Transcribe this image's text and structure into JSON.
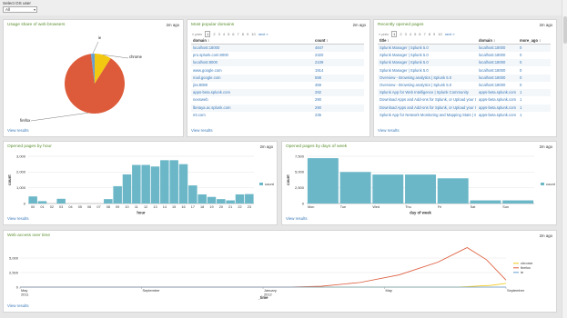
{
  "header": {
    "select_label": "Select OS user",
    "select_value": "All"
  },
  "p1": {
    "title": "Usage share of web browsers",
    "time": "2m ago",
    "link": "View results",
    "slices": [
      {
        "label": "chrome",
        "value": 9,
        "color": "#f2c811"
      },
      {
        "label": "firefox",
        "value": 89,
        "color": "#dd5b3a"
      },
      {
        "label": "ie",
        "value": 2,
        "color": "#6aa0cf"
      }
    ]
  },
  "p2": {
    "title": "Most popular domains",
    "time": "2m ago",
    "link": "View results",
    "pager": {
      "prev": "« prev",
      "pages": [
        "1",
        "2",
        "3",
        "4",
        "5",
        "6",
        "7",
        "8",
        "9",
        "10"
      ],
      "next": "next »"
    },
    "columns": [
      "domain ↕",
      "count ↕"
    ],
    "rows": [
      [
        "localhost:18000",
        "4847"
      ],
      [
        "pro.splunk.com:8000",
        "2320"
      ],
      [
        "localhost:8000",
        "2109"
      ],
      [
        "www.google.com",
        "1914"
      ],
      [
        "mail.google.com",
        "598"
      ],
      [
        "jira:8080",
        "459"
      ],
      [
        "apps-beta.splunk.com",
        "292"
      ],
      [
        "nexsweb",
        "290"
      ],
      [
        "lbetaya.ac.splunk.com",
        "290"
      ],
      [
        "mt.com",
        "235"
      ]
    ]
  },
  "p3": {
    "title": "Recently opened pages",
    "time": "2m ago",
    "link": "View results",
    "pager": {
      "prev": "« prev",
      "pages": [
        "1",
        "2",
        "3",
        "4",
        "5",
        "6",
        "7",
        "8",
        "9",
        "10"
      ],
      "next": "next »"
    },
    "columns": [
      "title ↕",
      "domain ↕",
      "more_ago ↕"
    ],
    "rows": [
      [
        "Splunk Manager | Splunk 5.0",
        "localhost:18000",
        "0"
      ],
      [
        "Splunk Manager | Splunk 5.0",
        "localhost:18000",
        "0"
      ],
      [
        "Splunk Manager | Splunk 5.0",
        "localhost:18000",
        "0"
      ],
      [
        "Splunk Manager | Splunk 5.0",
        "localhost:18000",
        "0"
      ],
      [
        "Overview - Browsing analytics | Splunk 5.0",
        "localhost:18000",
        "0"
      ],
      [
        "Overview - Browsing analytics | Splunk 5.0",
        "localhost:18000",
        "0"
      ],
      [
        "Splunk App for Web Intelligence | Splunk Community",
        "apps-beta.splunk.com",
        "1"
      ],
      [
        "Download Apps and Add-ons for Splunk, or Upload your Own | Splunk Community",
        "apps-beta.splunk.com",
        "1"
      ],
      [
        "Download Apps and Add-ons for Splunk, or Upload your Own | Splunk Community",
        "apps-beta.splunk.com",
        "1"
      ],
      [
        "Splunk App for Network Monitoring and Mapping Stats | Splunk Community",
        "apps-beta.splunk.com",
        "1"
      ]
    ]
  },
  "p4": {
    "title": "Opened pages by hour",
    "time": "2m ago",
    "link": "View results"
  },
  "p5": {
    "title": "Opened pages by days of week",
    "time": "2m ago",
    "link": "View results"
  },
  "p6": {
    "title": "Web access over time",
    "time": "2m ago",
    "link": "View results"
  },
  "colors": {
    "bar": "#6bb7c8",
    "chrome": "#f2c811",
    "firefox": "#dd5b3a",
    "ie": "#6aa0cf",
    "title_green": "#5b8f2f",
    "link_blue": "#3a79b8"
  },
  "chart_data": [
    {
      "type": "pie",
      "labels": [
        "chrome",
        "firefox",
        "ie"
      ],
      "values": [
        9,
        89,
        2
      ]
    },
    {
      "type": "bar",
      "categories": [
        "00",
        "01",
        "02",
        "03",
        "04",
        "05",
        "06",
        "07",
        "08",
        "09",
        "10",
        "11",
        "12",
        "13",
        "14",
        "15",
        "16",
        "17",
        "18",
        "19",
        "20",
        "21",
        "22",
        "23"
      ],
      "values": [
        450,
        150,
        0,
        300,
        0,
        0,
        0,
        0,
        280,
        1100,
        1850,
        2450,
        2450,
        2350,
        2750,
        2750,
        2500,
        1150,
        580,
        420,
        280,
        200,
        580,
        600
      ],
      "xlabel": "hour",
      "ylabel": "count",
      "yticks": [
        "0",
        "1,000",
        "2,000",
        "3,000"
      ],
      "ylim": [
        0,
        3000
      ],
      "legend": [
        "count"
      ],
      "legend_position": "right"
    },
    {
      "type": "bar",
      "categories": [
        "Mon",
        "Tue",
        "Wed",
        "Thu",
        "Fri",
        "Sat",
        "Sun"
      ],
      "values": [
        7200,
        5000,
        4600,
        4600,
        4000,
        500,
        500
      ],
      "xlabel": "day of week",
      "ylabel": "count",
      "yticks": [
        "0",
        "2,500",
        "5,000",
        "7,500"
      ],
      "ylim": [
        0,
        7500
      ],
      "legend": [
        "count"
      ],
      "legend_position": "right"
    },
    {
      "type": "line",
      "x_ticks": [
        "May\n2011",
        "September",
        "January\n2012",
        "May",
        "September"
      ],
      "xlabel": "_time",
      "yticks": [
        "0",
        "2,500",
        "5,000"
      ],
      "ylim": [
        0,
        7500
      ],
      "legend_position": "right",
      "series": [
        {
          "name": "chrome",
          "points": [
            [
              0.0,
              0
            ],
            [
              0.6,
              0
            ],
            [
              0.9,
              0
            ],
            [
              0.97,
              300
            ],
            [
              1.0,
              650
            ]
          ]
        },
        {
          "name": "firefox",
          "points": [
            [
              0.0,
              0
            ],
            [
              0.55,
              0
            ],
            [
              0.62,
              150
            ],
            [
              0.7,
              800
            ],
            [
              0.78,
              2100
            ],
            [
              0.86,
              4300
            ],
            [
              0.92,
              6800
            ],
            [
              0.96,
              4700
            ],
            [
              1.0,
              1200
            ]
          ]
        },
        {
          "name": "ie",
          "points": [
            [
              0.0,
              0
            ],
            [
              1.0,
              0
            ]
          ]
        }
      ]
    }
  ]
}
